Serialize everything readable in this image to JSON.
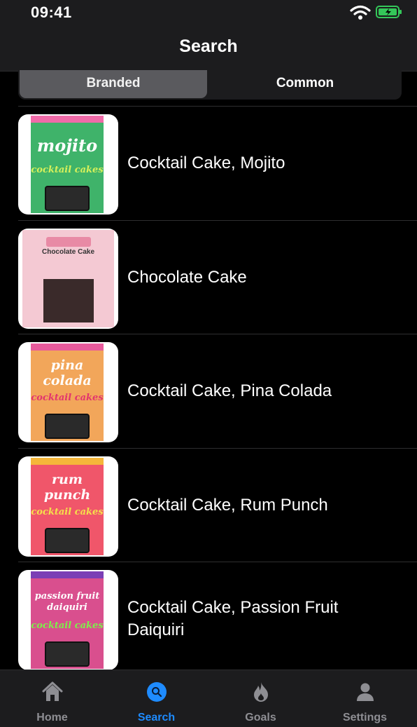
{
  "status_bar": {
    "time": "09:41"
  },
  "header": {
    "title": "Search"
  },
  "segments": [
    {
      "label": "Branded",
      "selected": true
    },
    {
      "label": "Common",
      "selected": false
    }
  ],
  "results": [
    {
      "name": "Cocktail Cake, Mojito",
      "pack_text": "mojito",
      "pack_sub": "cocktail cakes",
      "pack_color": "#3fb36a"
    },
    {
      "name": "Chocolate Cake",
      "pack_text": "Chocolate Cake",
      "pack_sub": "",
      "pack_color": "#f4c9d3"
    },
    {
      "name": "Cocktail Cake, Pina Colada",
      "pack_text": "pina colada",
      "pack_sub": "cocktail cakes",
      "pack_color": "#f2a65a"
    },
    {
      "name": "Cocktail Cake, Rum Punch",
      "pack_text": "rum punch",
      "pack_sub": "cocktail cakes",
      "pack_color": "#f0566a"
    },
    {
      "name": "Cocktail Cake, Passion Fruit Daiquiri",
      "pack_text": "passion fruit daiquiri",
      "pack_sub": "cocktail cakes",
      "pack_color": "#d94f8e"
    }
  ],
  "tab_bar": {
    "tabs": [
      {
        "label": "Home",
        "icon": "home-icon",
        "active": false
      },
      {
        "label": "Search",
        "icon": "search-icon",
        "active": true
      },
      {
        "label": "Goals",
        "icon": "flame-icon",
        "active": false
      },
      {
        "label": "Settings",
        "icon": "person-icon",
        "active": false
      }
    ]
  },
  "colors": {
    "accent": "#1e8bff",
    "background": "#000000",
    "bar": "#1c1c1e",
    "battery": "#34c759"
  }
}
